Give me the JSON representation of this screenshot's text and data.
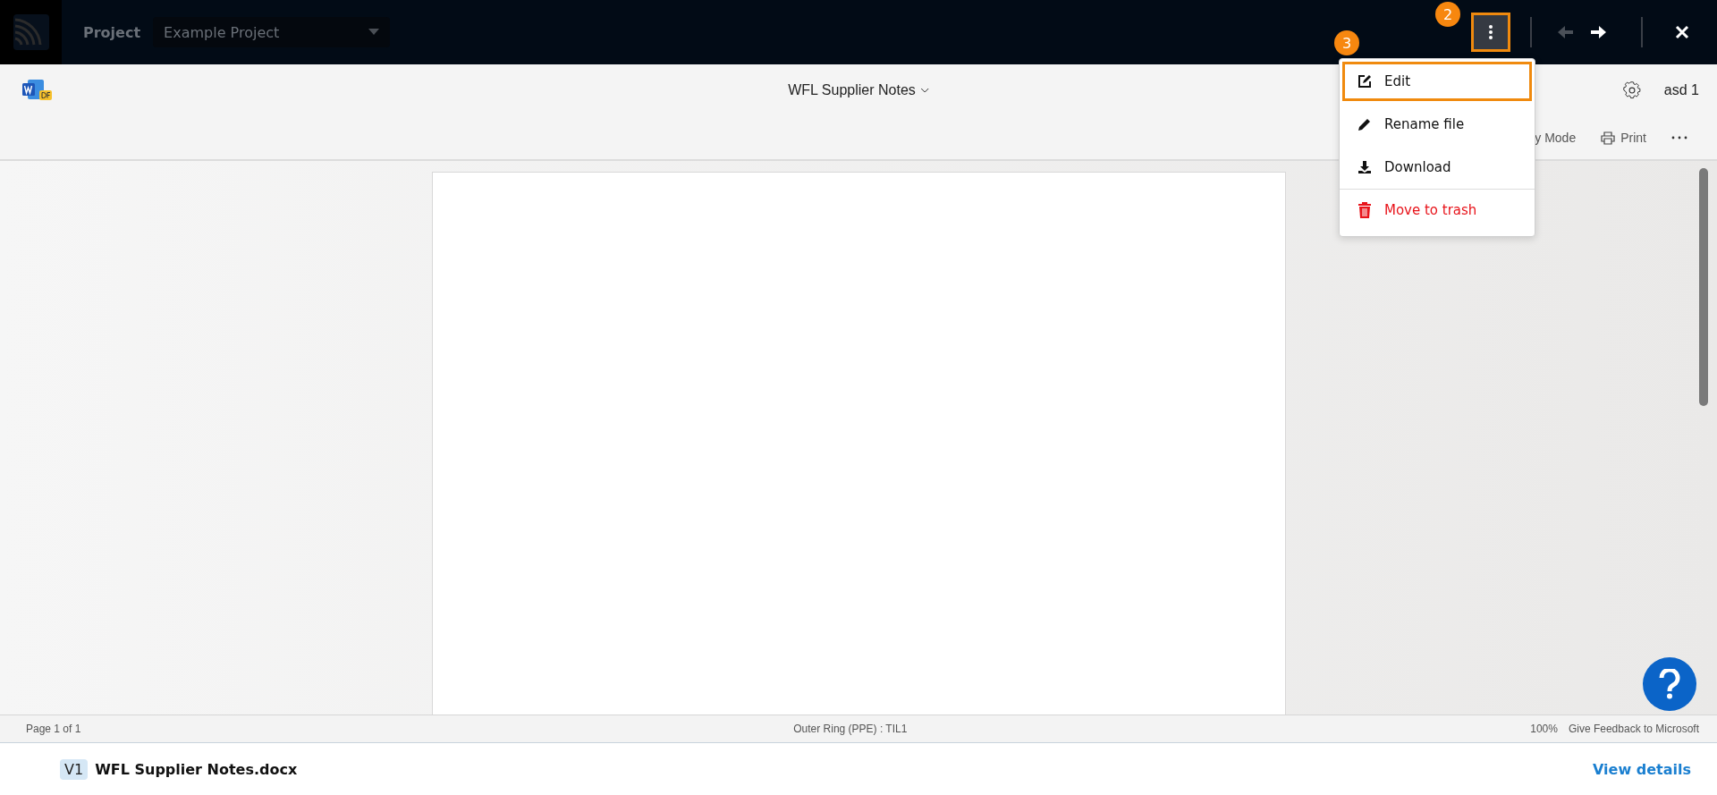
{
  "top_bar": {
    "project_label": "Project",
    "project_select": {
      "value": "Example Project"
    },
    "more_button": {
      "highlighted": true,
      "step_badge": "2"
    },
    "nav": [
      {
        "kind": "back",
        "disabled": true
      },
      {
        "kind": "forward",
        "disabled": false
      }
    ]
  },
  "document_header": {
    "title": "WFL Supplier Notes",
    "user": "asd 1",
    "toolbar": [
      {
        "kind": "text",
        "label": "y Mode"
      },
      {
        "kind": "print",
        "label": "Print"
      },
      {
        "kind": "more"
      }
    ]
  },
  "menu": {
    "step_badge": "3",
    "items": [
      {
        "kind": "edit",
        "label": "Edit",
        "highlighted": true,
        "danger": false
      },
      {
        "kind": "rename",
        "label": "Rename file",
        "highlighted": false,
        "danger": false
      },
      {
        "kind": "download",
        "label": "Download",
        "highlighted": false,
        "danger": false
      },
      {
        "kind": "trash",
        "label": "Move to trash",
        "highlighted": false,
        "danger": true
      }
    ]
  },
  "status_bar": {
    "page": "Page 1 of 1",
    "location": "Outer Ring (PPE) : TIL1",
    "zoom": "100%",
    "feedback": "Give Feedback to Microsoft"
  },
  "footer": {
    "version": "V1",
    "file_name": "WFL Supplier Notes.docx",
    "link": "View details"
  }
}
